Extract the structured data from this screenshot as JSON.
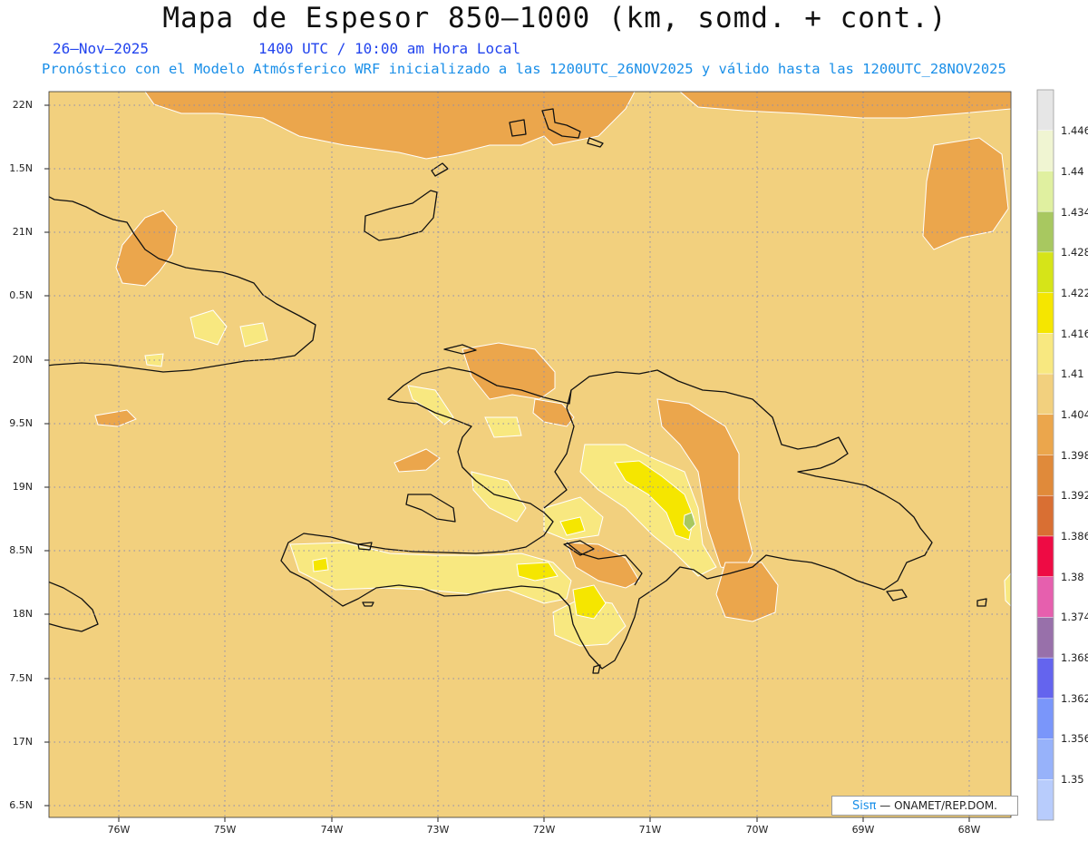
{
  "header": {
    "title": "Mapa de Espesor 850—1000 (km, somd. + cont.)",
    "date": "26—Nov—2025",
    "time": "1400 UTC / 10:00 am Hora Local",
    "forecast": "Pronóstico con el Modelo Atmósferico WRF inicializado a las 1200UTC_26NOV2025 y válido hasta las  1200UTC_28NOV2025"
  },
  "axes": {
    "lat_labels": [
      "22N",
      "1.5N",
      "21N",
      "0.5N",
      "20N",
      "9.5N",
      "19N",
      "8.5N",
      "18N",
      "7.5N",
      "17N",
      "6.5N"
    ],
    "lon_labels": [
      "76W",
      "75W",
      "74W",
      "73W",
      "72W",
      "71W",
      "70W",
      "69W",
      "68W"
    ]
  },
  "colorbar": {
    "labels": [
      "1.446",
      "1.44",
      "1.434",
      "1.428",
      "1.422",
      "1.416",
      "1.41",
      "1.404",
      "1.398",
      "1.392",
      "1.386",
      "1.38",
      "1.374",
      "1.368",
      "1.362",
      "1.356",
      "1.35"
    ],
    "colors": [
      "#e6e6e6",
      "#f0f5d2",
      "#e0f0a0",
      "#a8c860",
      "#d6e418",
      "#f5e600",
      "#f8e880",
      "#f2d07e",
      "#eba64c",
      "#e08a3a",
      "#d96f33",
      "#ee0b44",
      "#e65fae",
      "#9870aa",
      "#6464ee",
      "#7a96fa",
      "#97b2fa",
      "#b8ccfc"
    ]
  },
  "credit": {
    "brand": "Sisπ",
    "text": " — ONAMET/REP.DOM."
  }
}
